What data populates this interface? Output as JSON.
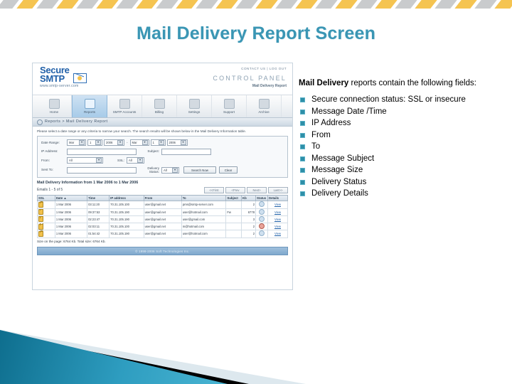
{
  "slide": {
    "title": "Mail Delivery Report Screen",
    "title_color": "#3a96b4",
    "bullet_color": "#2e8fa8"
  },
  "description": {
    "lead_bold": "Mail Delivery",
    "lead_rest": " reports contain the following fields:",
    "bullets": [
      "Secure connection status: SSL or insecure",
      "Message Date /Time",
      "IP Address",
      "From",
      "To",
      "Message Subject",
      "Message Size",
      "Delivery Status",
      "Delivery Details"
    ]
  },
  "screenshot": {
    "logo": {
      "line1": "Secure",
      "line2": "SMTP",
      "url": "www.smtp-server.com"
    },
    "header": {
      "links": "CONTACT US  |  LOG OUT",
      "control_panel": "CONTROL PANEL",
      "subtitle": "Mail Delivery Report"
    },
    "nav": [
      {
        "label": "Home",
        "icon": "home-icon",
        "active": false
      },
      {
        "label": "Reports",
        "icon": "report-icon",
        "active": true
      },
      {
        "label": "SMTP Accounts",
        "icon": "users-icon",
        "active": false
      },
      {
        "label": "Billing",
        "icon": "billing-icon",
        "active": false
      },
      {
        "label": "Settings",
        "icon": "settings-icon",
        "active": false
      },
      {
        "label": "Support",
        "icon": "support-icon",
        "active": false
      },
      {
        "label": "Archive",
        "icon": "archive-icon",
        "active": false
      }
    ],
    "breadcrumb": "Reports > Mail Delivery Report",
    "intro": "Please select a date range or any criteria to narrow your search. The search results will be shown below in the Mail Delivery Information table.",
    "form": {
      "date_range_label": "Date Range:",
      "from_month": "Mar",
      "from_day": "1",
      "from_year": "2006",
      "separator": "-",
      "to_month": "Mar",
      "to_day": "1",
      "to_year": "2006",
      "ip_label": "IP Address:",
      "ip_value": "",
      "subject_label": "Subject:",
      "subject_value": "",
      "from_label": "From:",
      "from_value": "All",
      "ssl_label": "SSL:",
      "ssl_value": "All",
      "sent_to_label": "Sent To:",
      "sent_to_value": "",
      "delivery_status_label": "Delivery Status:",
      "delivery_status_value": "All",
      "search_button": "Search Now",
      "clear_button": "Clear"
    },
    "results": {
      "title": "Mail Delivery Information from 1 Mar 2006 to 1 Mar 2006",
      "count": "Emails 1 - 5 of 5",
      "pager": [
        "<<First",
        "<Prev",
        "Next>",
        "Last>>"
      ],
      "columns": [
        "SSL",
        "Date ▲",
        "Time",
        "IP address",
        "From",
        "To",
        "Subject",
        "Kb",
        "Status",
        "Details"
      ],
      "rows": [
        {
          "ssl": "lock-icon",
          "date": "1 Mar 2006",
          "time": "03:11:20",
          "ip": "70.31.105.100",
          "from": "user@gmail.net",
          "to": "pms@smtp-server.com",
          "subject": "",
          "kb": "2",
          "status": "ok",
          "details": "View"
        },
        {
          "ssl": "lock-icon",
          "date": "1 Mar 2006",
          "time": "09:37:53",
          "ip": "70.31.105.190",
          "from": "user@gmail.net",
          "to": "user@hotmail.com",
          "subject": "Fw",
          "kb": "6778",
          "status": "ok",
          "details": "View"
        },
        {
          "ssl": "lock-icon",
          "date": "1 Mar 2006",
          "time": "02:23:47",
          "ip": "70.31.105.190",
          "from": "user@gmail.net",
          "to": "user@gmail.com",
          "subject": "",
          "kb": "3",
          "status": "ok",
          "details": "View"
        },
        {
          "ssl": "lock-icon",
          "date": "1 Mar 2006",
          "time": "02:03:11",
          "ip": "70.31.105.100",
          "from": "user@gmail.net",
          "to": "m@hotmail.com",
          "subject": "",
          "kb": "2",
          "status": "err",
          "details": "View"
        },
        {
          "ssl": "lock-icon",
          "date": "1 Mar 2006",
          "time": "01:54:42",
          "ip": "70.31.105.190",
          "from": "user@gmail.net",
          "to": "user@hotmail.com",
          "subject": "",
          "kb": "2",
          "status": "ok",
          "details": "View"
        }
      ],
      "size_line": "Size on the page: 6764 Kb. Total size: 6764 Kb."
    },
    "footer": "© 1998-2006 Soft Technologies Inc."
  }
}
